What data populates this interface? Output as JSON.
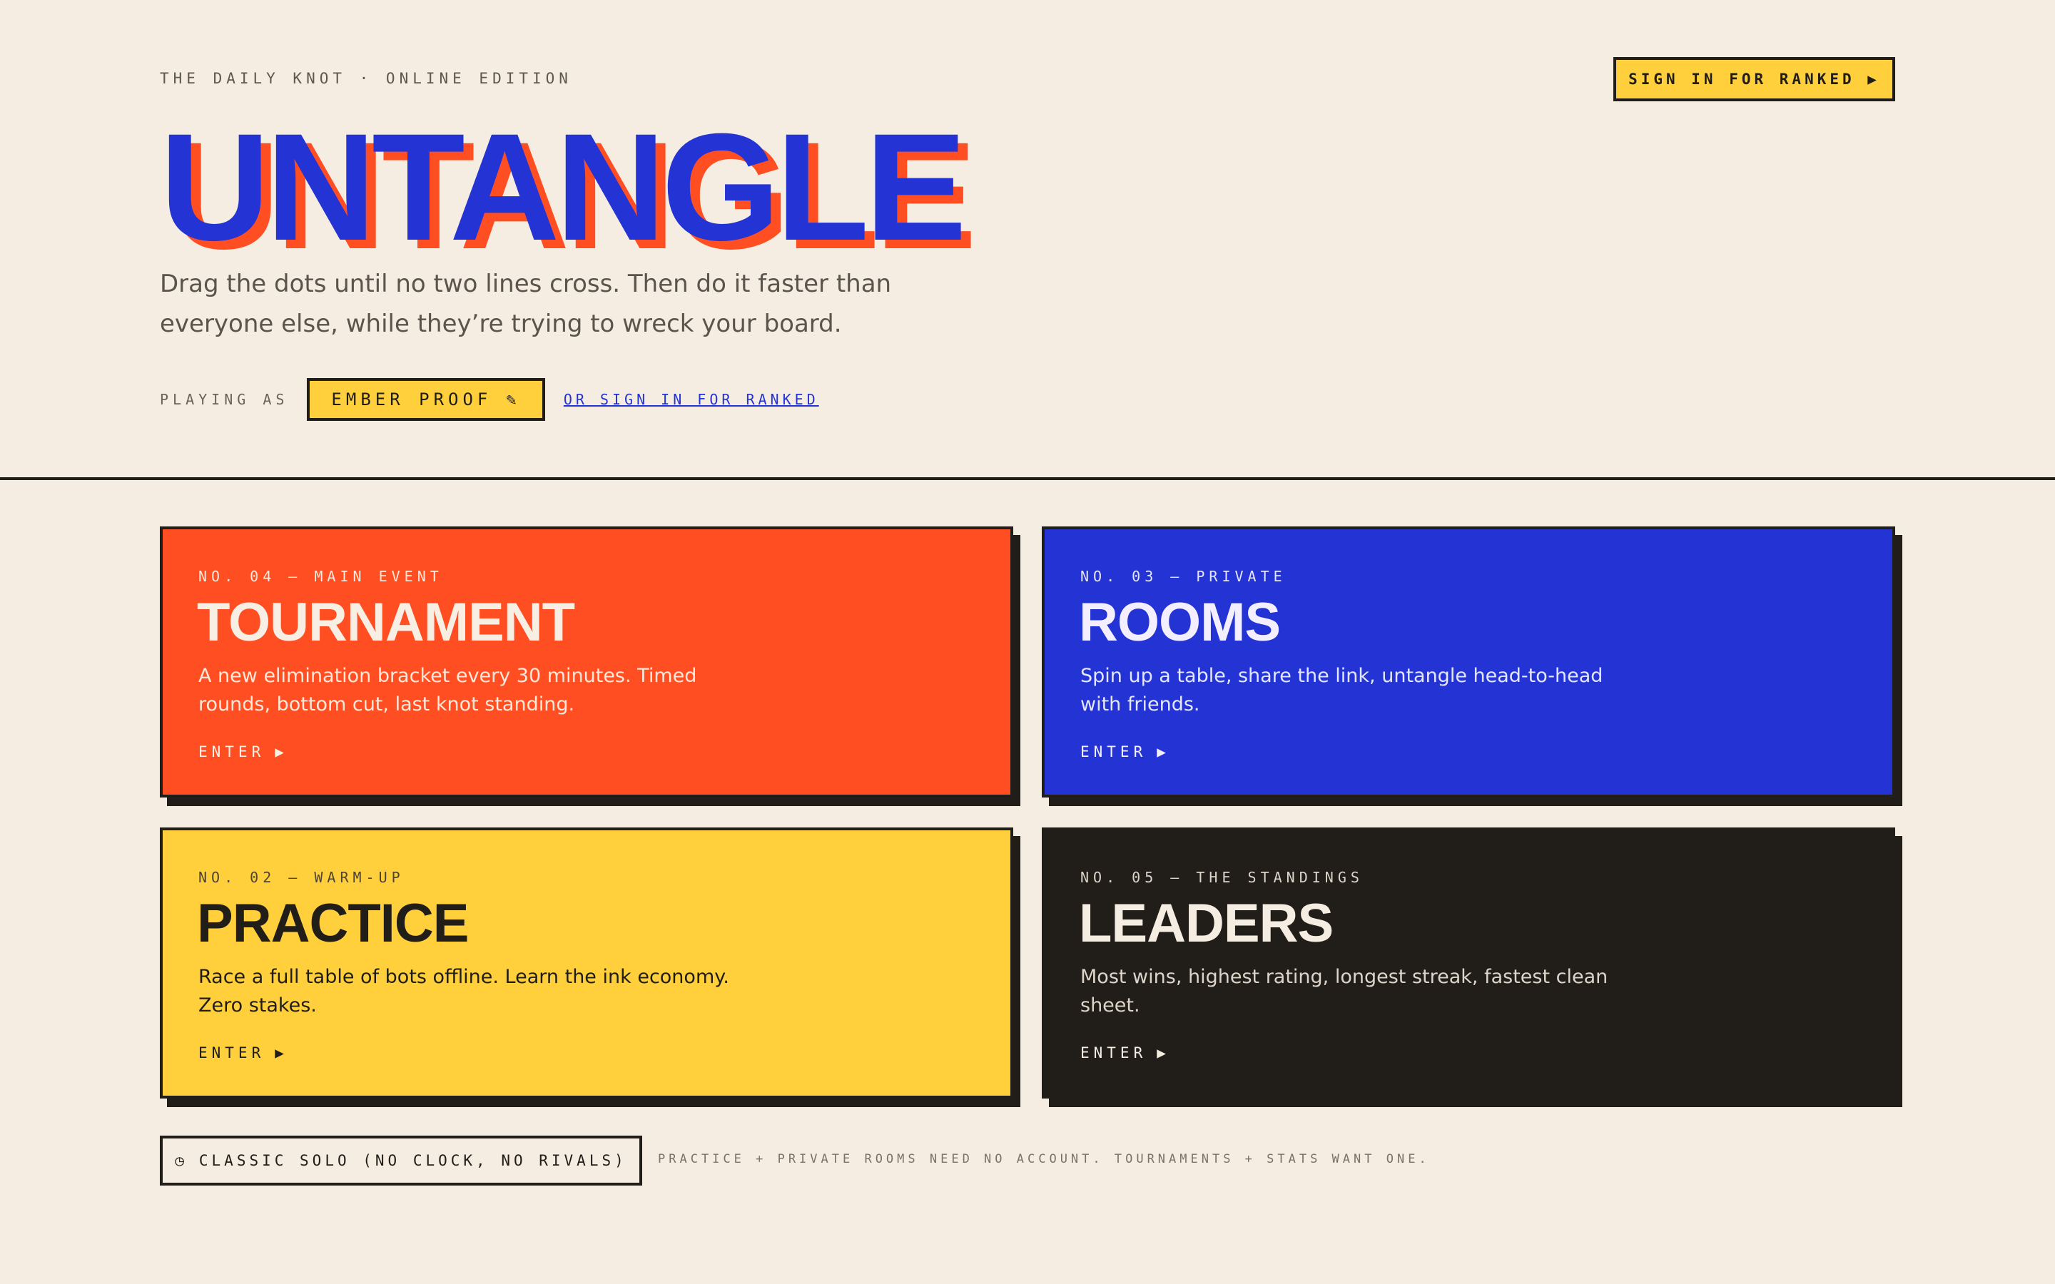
{
  "header": {
    "kicker": "THE DAILY KNOT · ONLINE EDITION",
    "signin_button": "SIGN IN FOR RANKED ▶",
    "title": "UNTANGLE",
    "subtitle": "Drag the dots until no two lines cross. Then do it faster than everyone else, while they’re trying to wreck your board.",
    "playing_as_label": "PLAYING AS",
    "player_name": "EMBER PROOF",
    "edit_icon": "pencil-icon",
    "alt_signin_link": "OR SIGN IN FOR RANKED"
  },
  "modes": [
    {
      "tag": "NO. 04 — MAIN EVENT",
      "name": "TOURNAMENT",
      "desc": "A new elimination bracket every 30 minutes. Timed rounds, bottom cut, last knot standing.",
      "enter": "ENTER",
      "color": "#ff4f22"
    },
    {
      "tag": "NO. 03 — PRIVATE",
      "name": "ROOMS",
      "desc": "Spin up a table, share the link, untangle head-to-head with friends.",
      "enter": "ENTER",
      "color": "#2433d3"
    },
    {
      "tag": "NO. 02 — WARM-UP",
      "name": "PRACTICE",
      "desc": "Race a full table of bots offline. Learn the ink economy. Zero stakes.",
      "enter": "ENTER",
      "color": "#ffd03c"
    },
    {
      "tag": "NO. 05 — THE STANDINGS",
      "name": "LEADERS",
      "desc": "Most wins, highest rating, longest streak, fastest clean sheet.",
      "enter": "ENTER",
      "color": "#211d19"
    }
  ],
  "footer": {
    "classic_icon": "clock-icon",
    "classic_button": "CLASSIC SOLO (NO CLOCK, NO RIVALS)",
    "note": "PRACTICE + PRIVATE ROOMS NEED NO ACCOUNT. TOURNAMENTS + STATS WANT ONE."
  },
  "colors": {
    "background": "#f5ede2",
    "ink": "#211d19",
    "blue": "#2433d3",
    "orange": "#ff4f22",
    "yellow": "#ffd03c"
  }
}
